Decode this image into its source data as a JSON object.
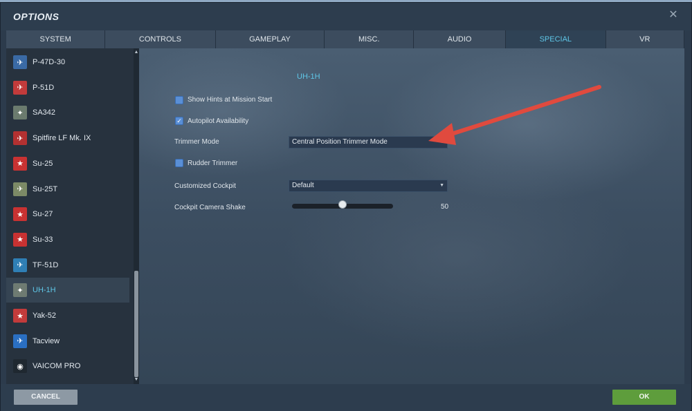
{
  "window": {
    "title": "OPTIONS"
  },
  "tabs": [
    {
      "label": "SYSTEM",
      "active": false
    },
    {
      "label": "CONTROLS",
      "active": false
    },
    {
      "label": "GAMEPLAY",
      "active": false
    },
    {
      "label": "MISC.",
      "active": false
    },
    {
      "label": "AUDIO",
      "active": false
    },
    {
      "label": "SPECIAL",
      "active": true
    },
    {
      "label": "VR",
      "active": false
    }
  ],
  "sidebar": {
    "items": [
      {
        "label": "P-47D-30",
        "icon": "aircraft-icon",
        "color": "#3a6aa5",
        "glyph": "✈"
      },
      {
        "label": "P-51D",
        "icon": "aircraft-icon",
        "color": "#c23b3b",
        "glyph": "✈"
      },
      {
        "label": "SA342",
        "icon": "helicopter-icon",
        "color": "#6b7b6e",
        "glyph": "✦"
      },
      {
        "label": "Spitfire LF Mk. IX",
        "icon": "aircraft-icon",
        "color": "#b33131",
        "glyph": "✈"
      },
      {
        "label": "Su-25",
        "icon": "aircraft-icon",
        "color": "#c83232",
        "glyph": "★"
      },
      {
        "label": "Su-25T",
        "icon": "aircraft-icon",
        "color": "#7c8a66",
        "glyph": "✈"
      },
      {
        "label": "Su-27",
        "icon": "aircraft-icon",
        "color": "#c83232",
        "glyph": "★"
      },
      {
        "label": "Su-33",
        "icon": "aircraft-icon",
        "color": "#c83232",
        "glyph": "★"
      },
      {
        "label": "TF-51D",
        "icon": "aircraft-icon",
        "color": "#2f7fb5",
        "glyph": "✈"
      },
      {
        "label": "UH-1H",
        "icon": "helicopter-icon",
        "color": "#6e7b72",
        "glyph": "✦",
        "active": true
      },
      {
        "label": "Yak-52",
        "icon": "aircraft-icon",
        "color": "#c23b3b",
        "glyph": "★"
      },
      {
        "label": "Tacview",
        "icon": "tacview-icon",
        "color": "#2a6fc2",
        "glyph": "✈"
      },
      {
        "label": "VAICOM PRO",
        "icon": "vaicom-icon",
        "color": "#1f2830",
        "glyph": "◉"
      }
    ]
  },
  "main": {
    "module_title": "UH-1H",
    "show_hints": {
      "label": "Show Hints at Mission Start",
      "checked": false
    },
    "autopilot": {
      "label": "Autopilot Availability",
      "checked": true
    },
    "trimmer_mode": {
      "label": "Trimmer Mode",
      "value": "Central Position Trimmer Mode"
    },
    "rudder_trimmer": {
      "label": "Rudder Trimmer",
      "checked": false
    },
    "customized_cockpit": {
      "label": "Customized Cockpit",
      "value": "Default"
    },
    "camera_shake": {
      "label": "Cockpit Camera Shake",
      "value": "50",
      "level": 0.5
    }
  },
  "footer": {
    "cancel_label": "CANCEL",
    "ok_label": "OK"
  },
  "colors": {
    "accent": "#5fc7e8",
    "ok": "#5e9d3c",
    "annotation_arrow": "#e04a3e"
  }
}
